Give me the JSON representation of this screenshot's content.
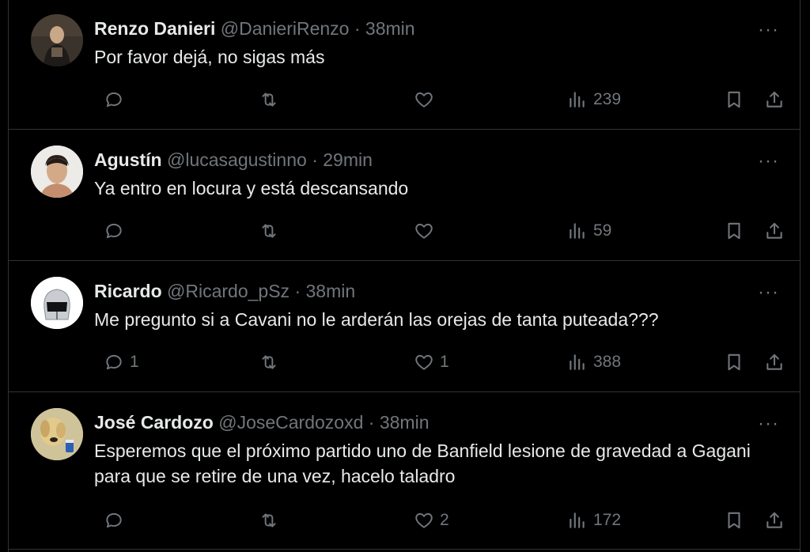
{
  "tweets": [
    {
      "name": "Renzo Danieri",
      "handle": "@DanieriRenzo",
      "time": "38min",
      "text": "Por favor dejá, no sigas más",
      "replies": "",
      "likes": "",
      "views": "239",
      "avatar": "dark-portrait"
    },
    {
      "name": "Agustín",
      "handle": "@lucasagustinno",
      "time": "29min",
      "text": "Ya entro en locura y está descansando",
      "replies": "",
      "likes": "",
      "views": "59",
      "avatar": "face-portrait"
    },
    {
      "name": "Ricardo",
      "handle": "@Ricardo_pSz",
      "time": "38min",
      "text": "Me pregunto si a Cavani no le arderán las orejas de tanta puteada???",
      "replies": "1",
      "likes": "1",
      "views": "388",
      "avatar": "helmet"
    },
    {
      "name": "José Cardozo",
      "handle": "@JoseCardozoxd",
      "time": "38min",
      "text": "Esperemos que el próximo partido uno de Banfield lesione de gravedad a Gagani para que se retire de una vez, hacelo taladro",
      "replies": "",
      "likes": "2",
      "views": "172",
      "avatar": "dog"
    }
  ],
  "separator": "·",
  "more_label": "···",
  "colors": {
    "background": "#000000",
    "text": "#e7e9ea",
    "muted": "#71767b",
    "border": "#2f3336"
  }
}
